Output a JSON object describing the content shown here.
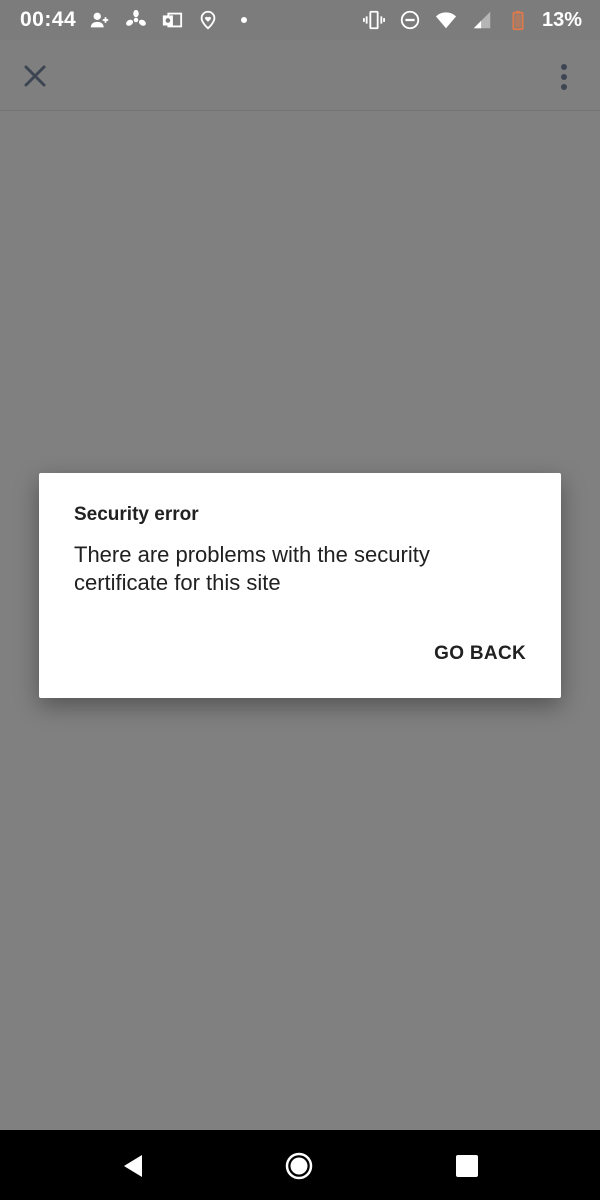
{
  "status_bar": {
    "time": "00:44",
    "battery_percent": "13%",
    "left_icons": [
      "add-person-icon",
      "fan-icon",
      "outlook-icon",
      "location-heart-icon",
      "dot-icon"
    ],
    "right_icons": [
      "vibrate-icon",
      "do-not-disturb-icon",
      "wifi-icon",
      "signal-icon",
      "battery-icon"
    ],
    "battery_color": "#e07a4a"
  },
  "toolbar": {
    "close_icon": "close-icon",
    "menu_icon": "more-vert-icon"
  },
  "dialog": {
    "title": "Security error",
    "message": "There are problems with the security certificate for this site",
    "button_label": "GO BACK"
  },
  "nav_bar": {
    "back_icon": "back-icon",
    "home_icon": "home-icon",
    "recents_icon": "recents-icon"
  }
}
